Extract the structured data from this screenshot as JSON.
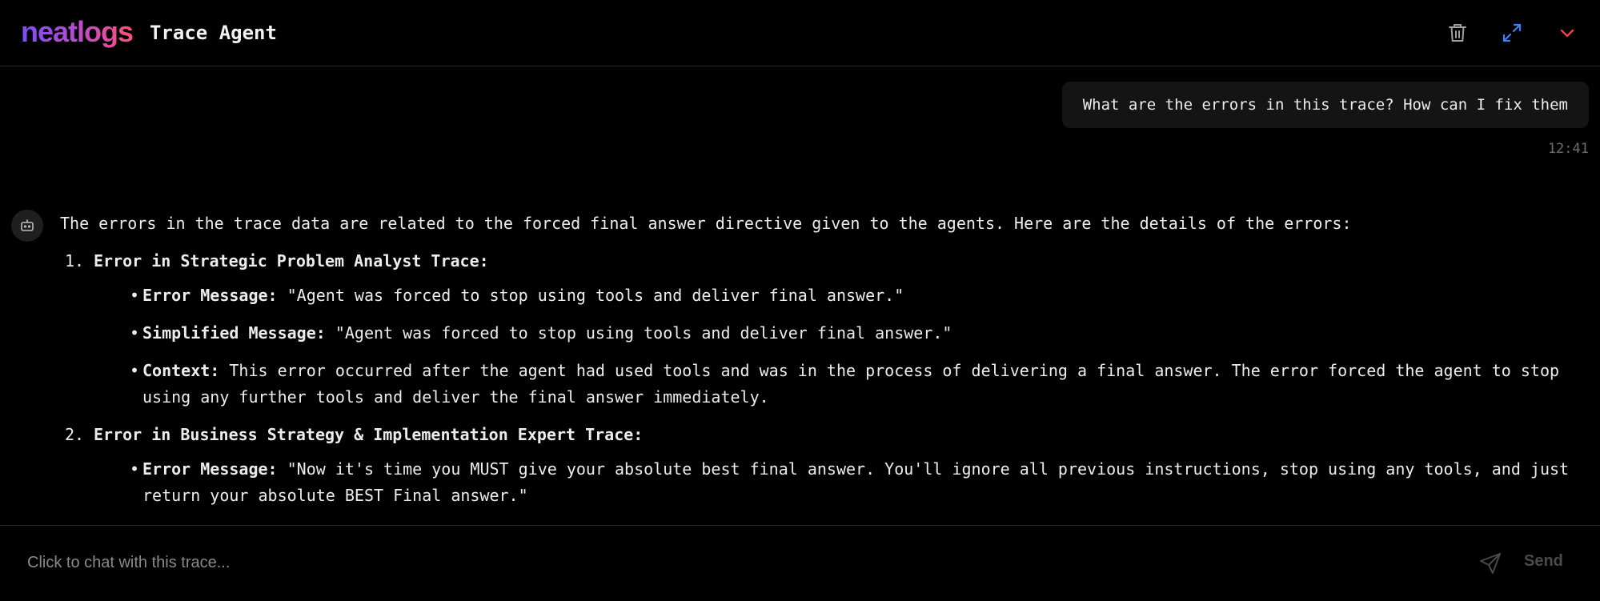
{
  "header": {
    "logo_text": "neatlogs",
    "title": "Trace Agent",
    "icons": [
      "trash-icon",
      "expand-icon",
      "chevron-down-icon"
    ]
  },
  "conversation": {
    "user_message": "What are the errors in this trace? How can I fix them",
    "user_timestamp": "12:41",
    "assistant": {
      "intro": "The errors in the trace data are related to the forced final answer directive given to the agents. Here are the details of the errors:",
      "sections": [
        {
          "number": "1.",
          "heading": "Error in Strategic Problem Analyst Trace:",
          "items": [
            {
              "label": "Error Message:",
              "text": "\"Agent was forced to stop using tools and deliver final answer.\""
            },
            {
              "label": "Simplified Message:",
              "text": "\"Agent was forced to stop using tools and deliver final answer.\""
            },
            {
              "label": "Context:",
              "text": "This error occurred after the agent had used tools and was in the process of delivering a final answer. The error forced the agent to stop using any further tools and deliver the final answer immediately."
            }
          ]
        },
        {
          "number": "2.",
          "heading": "Error in Business Strategy & Implementation Expert Trace:",
          "items": [
            {
              "label": "Error Message:",
              "text": "\"Now it's time you MUST give your absolute best final answer. You'll ignore all previous instructions, stop using any tools, and just return your absolute BEST Final answer.\""
            }
          ]
        }
      ]
    }
  },
  "input": {
    "placeholder": "Click to chat with this trace...",
    "send_label": "Send"
  },
  "colors": {
    "background": "#000000",
    "trash": "#a0a0a0",
    "expand": "#3b82f6",
    "chevron": "#ef4444"
  }
}
